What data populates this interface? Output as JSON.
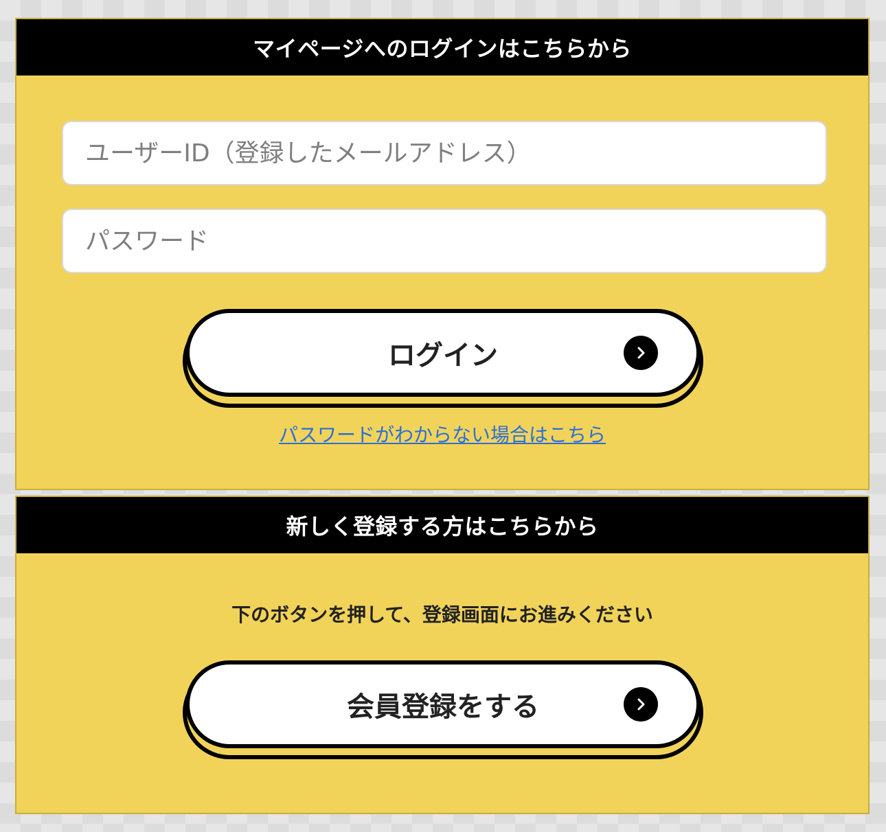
{
  "login_section": {
    "header": "マイページへのログインはこちらから",
    "userid_placeholder": "ユーザーID（登録したメールアドレス）",
    "password_placeholder": "パスワード",
    "login_button_label": "ログイン",
    "forgot_password_link": "パスワードがわからない場合はこちら"
  },
  "register_section": {
    "header": "新しく登録する方はこちらから",
    "description": "下のボタンを押して、登録画面にお進みください",
    "register_button_label": "会員登録をする"
  },
  "icons": {
    "button_arrow": "chevron-right-circle-icon"
  },
  "colors": {
    "panel_background": "#f2d35a",
    "header_background": "#000000",
    "link": "#2b6fd6"
  }
}
